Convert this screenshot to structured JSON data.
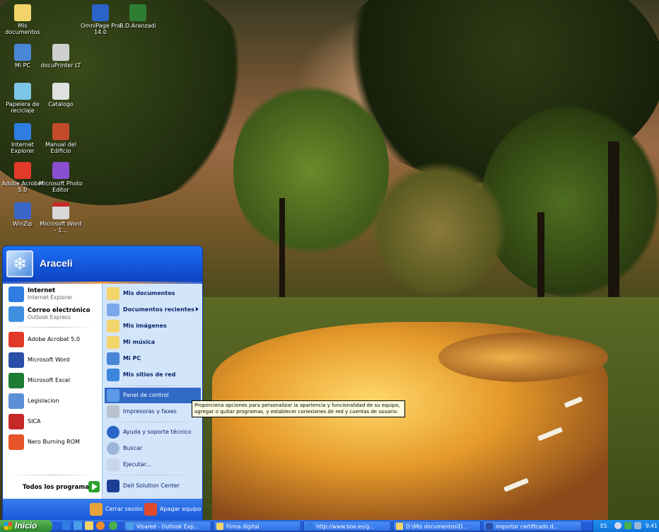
{
  "desktop": {
    "icons": [
      {
        "label": "Mis documentos",
        "icon": "my-documents-folder-icon",
        "color": "#f2d46a"
      },
      {
        "label": "OmniPage Pro 14.0",
        "icon": "omnipage-icon",
        "color": "#2a64c8"
      },
      {
        "label": "B.D.Aranzadi",
        "icon": "aranzadi-icon",
        "color": "#2e7d32"
      },
      {
        "label": "Mi PC",
        "icon": "my-computer-icon",
        "color": "#4a86d6"
      },
      {
        "label": "docuPrinter LT",
        "icon": "docuprinter-icon",
        "color": "#cfcfcf"
      },
      {
        "label": "Papelera de reciclaje",
        "icon": "recycle-bin-icon",
        "color": "#7cc7e8"
      },
      {
        "label": "Catalogo",
        "icon": "une-catalog-icon",
        "color": "#e0e0e0"
      },
      {
        "label": "Internet Explorer",
        "icon": "internet-explorer-icon",
        "color": "#2f7de1"
      },
      {
        "label": "Manual del Edificio",
        "icon": "manual-icon",
        "color": "#c34a2a"
      },
      {
        "label": "Adobe Acrobat 5.0",
        "icon": "acrobat-icon",
        "color": "#e23a2a"
      },
      {
        "label": "Microsoft Photo Editor",
        "icon": "photo-editor-icon",
        "color": "#8a4fd0"
      },
      {
        "label": "WinZip",
        "icon": "winzip-icon",
        "color": "#3a66c8"
      },
      {
        "label": "Microsoft Word - 1...",
        "icon": "pdf-document-icon",
        "color": "#d8d8d8"
      }
    ]
  },
  "start_menu": {
    "user_name": "Araceli",
    "pinned": [
      {
        "title": "Internet",
        "subtitle": "Internet Explorer",
        "icon": "internet-explorer-icon",
        "color": "#2f7de1"
      },
      {
        "title": "Correo electrónico",
        "subtitle": "Outlook Express",
        "icon": "outlook-express-icon",
        "color": "#3f8fe0"
      }
    ],
    "recent": [
      {
        "label": "Adobe Acrobat 5.0",
        "icon": "acrobat-icon",
        "color": "#e23a2a"
      },
      {
        "label": "Microsoft Word",
        "icon": "word-icon",
        "color": "#2b4fa8"
      },
      {
        "label": "Microsoft Excel",
        "icon": "excel-icon",
        "color": "#1e7b34"
      },
      {
        "label": "Legislacion",
        "icon": "legislacion-icon",
        "color": "#5b8fd6"
      },
      {
        "label": "SICA",
        "icon": "sica-icon",
        "color": "#c62828"
      },
      {
        "label": "Nero Burning ROM",
        "icon": "nero-icon",
        "color": "#e8542a"
      }
    ],
    "all_programs_label": "Todos los programas",
    "places": [
      {
        "label": "Mis documentos",
        "icon": "folder-icon",
        "color": "#f2d46a",
        "bold": true
      },
      {
        "label": "Documentos recientes",
        "icon": "recent-docs-icon",
        "color": "#7aa7e8",
        "bold": true,
        "submenu": true
      },
      {
        "label": "Mis imágenes",
        "icon": "my-pictures-icon",
        "color": "#f2d46a",
        "bold": true
      },
      {
        "label": "Mi música",
        "icon": "my-music-icon",
        "color": "#f2d46a",
        "bold": true
      },
      {
        "label": "Mi PC",
        "icon": "my-computer-icon",
        "color": "#4a86d6",
        "bold": true
      },
      {
        "label": "Mis sitios de red",
        "icon": "network-places-icon",
        "color": "#3c86dc",
        "bold": true
      },
      {
        "label": "Panel de control",
        "icon": "control-panel-icon",
        "color": "#5b9ae6",
        "selected": true
      },
      {
        "label": "Impresoras y faxes",
        "icon": "printer-icon",
        "color": "#b8c2cf"
      },
      {
        "label": "Ayuda y soporte técnico",
        "icon": "help-icon",
        "color": "#2a64c8"
      },
      {
        "label": "Buscar",
        "icon": "search-icon",
        "color": "#9bb6d9"
      },
      {
        "label": "Ejecutar...",
        "icon": "run-icon",
        "color": "#c9d6ea"
      },
      {
        "label": "Dell Solution Center",
        "icon": "dell-icon",
        "color": "#1c3f94"
      }
    ],
    "logoff_label": "Cerrar sesión",
    "shutdown_label": "Apagar equipo",
    "logoff_color": "#e8a23a",
    "shutdown_color": "#e04a2a"
  },
  "tooltip": {
    "text": "Proporciona opciones para personalizar la apariencia y funcionalidad de su equipo, agregar o quitar programas, y establecer conexiones de red y cuentas de usuario."
  },
  "taskbar": {
    "start_label": "Inicio",
    "quick_launch": [
      {
        "icon": "internet-explorer-icon",
        "color": "#2f7de1"
      },
      {
        "icon": "outlook-express-icon",
        "color": "#4aa0e8"
      },
      {
        "icon": "show-desktop-icon",
        "color": "#f2d46a"
      },
      {
        "icon": "media-player-icon",
        "color": "#f08a2a"
      },
      {
        "icon": "messenger-icon",
        "color": "#4ab04a"
      }
    ],
    "tasks": [
      {
        "label": "Visared - Outlook Exp...",
        "icon": "outlook-express-icon",
        "color": "#4aa0e8"
      },
      {
        "label": "Firma digital",
        "icon": "folder-icon",
        "color": "#f2d46a"
      },
      {
        "label": "http://www.boe.es/g...",
        "icon": "internet-explorer-icon",
        "color": "#2f7de1"
      },
      {
        "label": "D:\\Mis documentos\\D...",
        "icon": "folder-icon",
        "color": "#f2d46a"
      },
      {
        "label": "importar certificado.d...",
        "icon": "word-icon",
        "color": "#2b4fa8"
      }
    ],
    "tray": {
      "language": "ES",
      "clock": "9:41"
    }
  }
}
